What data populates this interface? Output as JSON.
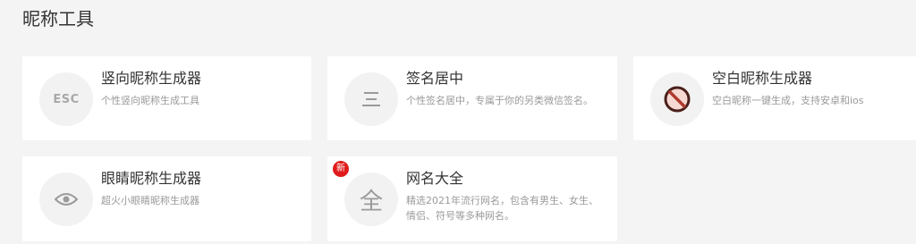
{
  "page": {
    "title": "昵称工具"
  },
  "cards": [
    {
      "title": "竖向昵称生成器",
      "desc": "个性竖向昵称生成工具",
      "icon": "esc-icon",
      "icon_text": "ESC"
    },
    {
      "title": "签名居中",
      "desc": "个性签名居中，专属于你的另类微信签名。",
      "icon": "menu-lines-icon"
    },
    {
      "title": "空白昵称生成器",
      "desc": "空白昵称一键生成，支持安卓和ios",
      "icon": "prohibited-icon",
      "icon_color": "#c0392b"
    },
    {
      "title": "眼睛昵称生成器",
      "desc": "超火小眼睛昵称生成器",
      "icon": "eye-icon"
    },
    {
      "title": "网名大全",
      "desc": "精选2021年流行网名，包含有男生、女生、情侣、符号等多种网名。",
      "icon": "quan-character-icon",
      "icon_text": "全",
      "badge": "新",
      "badge_color": "#e01b1b"
    }
  ]
}
